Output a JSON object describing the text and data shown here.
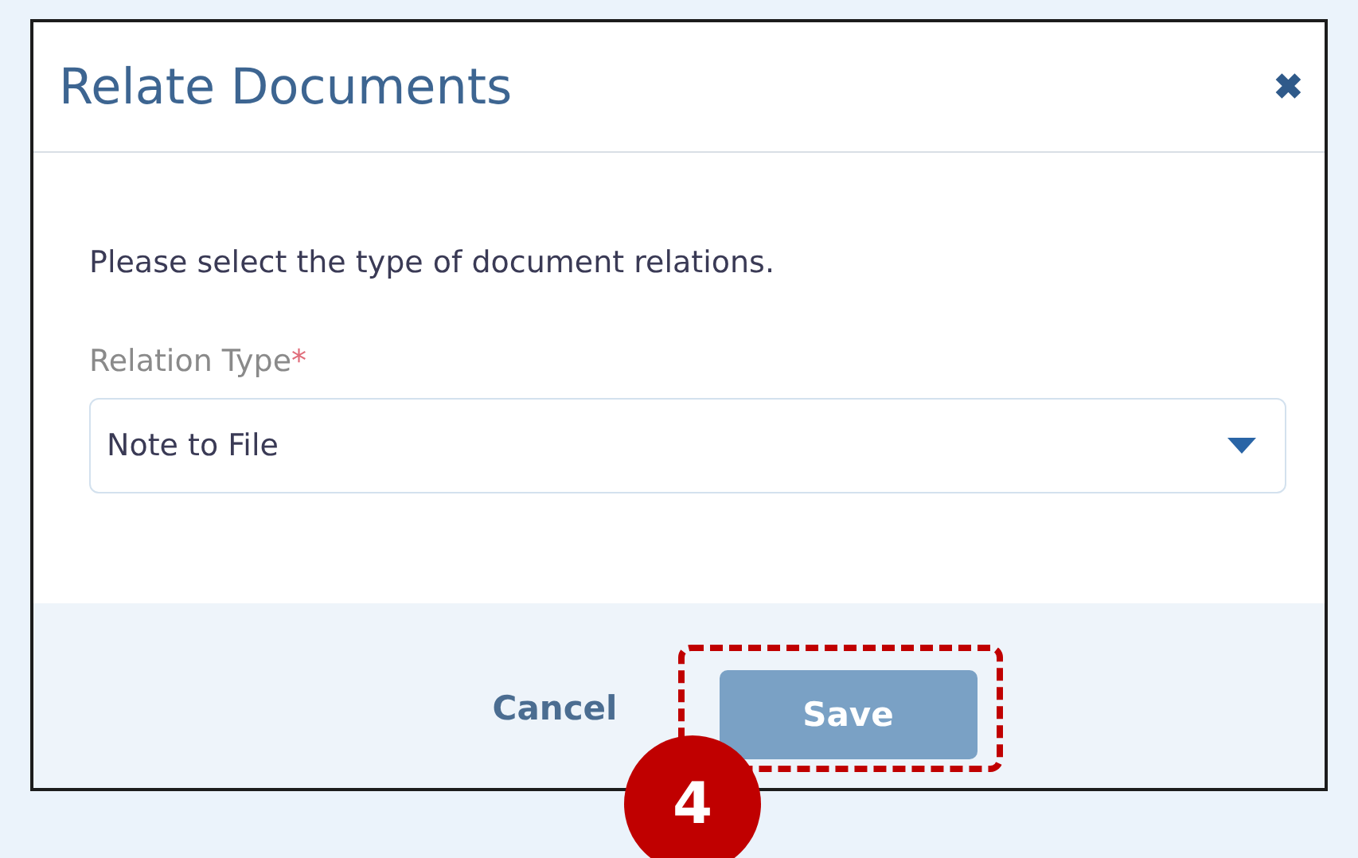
{
  "dialog": {
    "title": "Relate Documents",
    "close_icon": "✖"
  },
  "body": {
    "instruction": "Please select the type of document relations.",
    "field": {
      "label": "Relation Type",
      "required_mark": "*",
      "value": "Note to File"
    }
  },
  "footer": {
    "buttons": [
      {
        "label": "Cancel",
        "kind": "link"
      },
      {
        "label": "Save",
        "kind": "primary",
        "highlighted": true
      }
    ]
  },
  "callout": {
    "step": "4"
  }
}
